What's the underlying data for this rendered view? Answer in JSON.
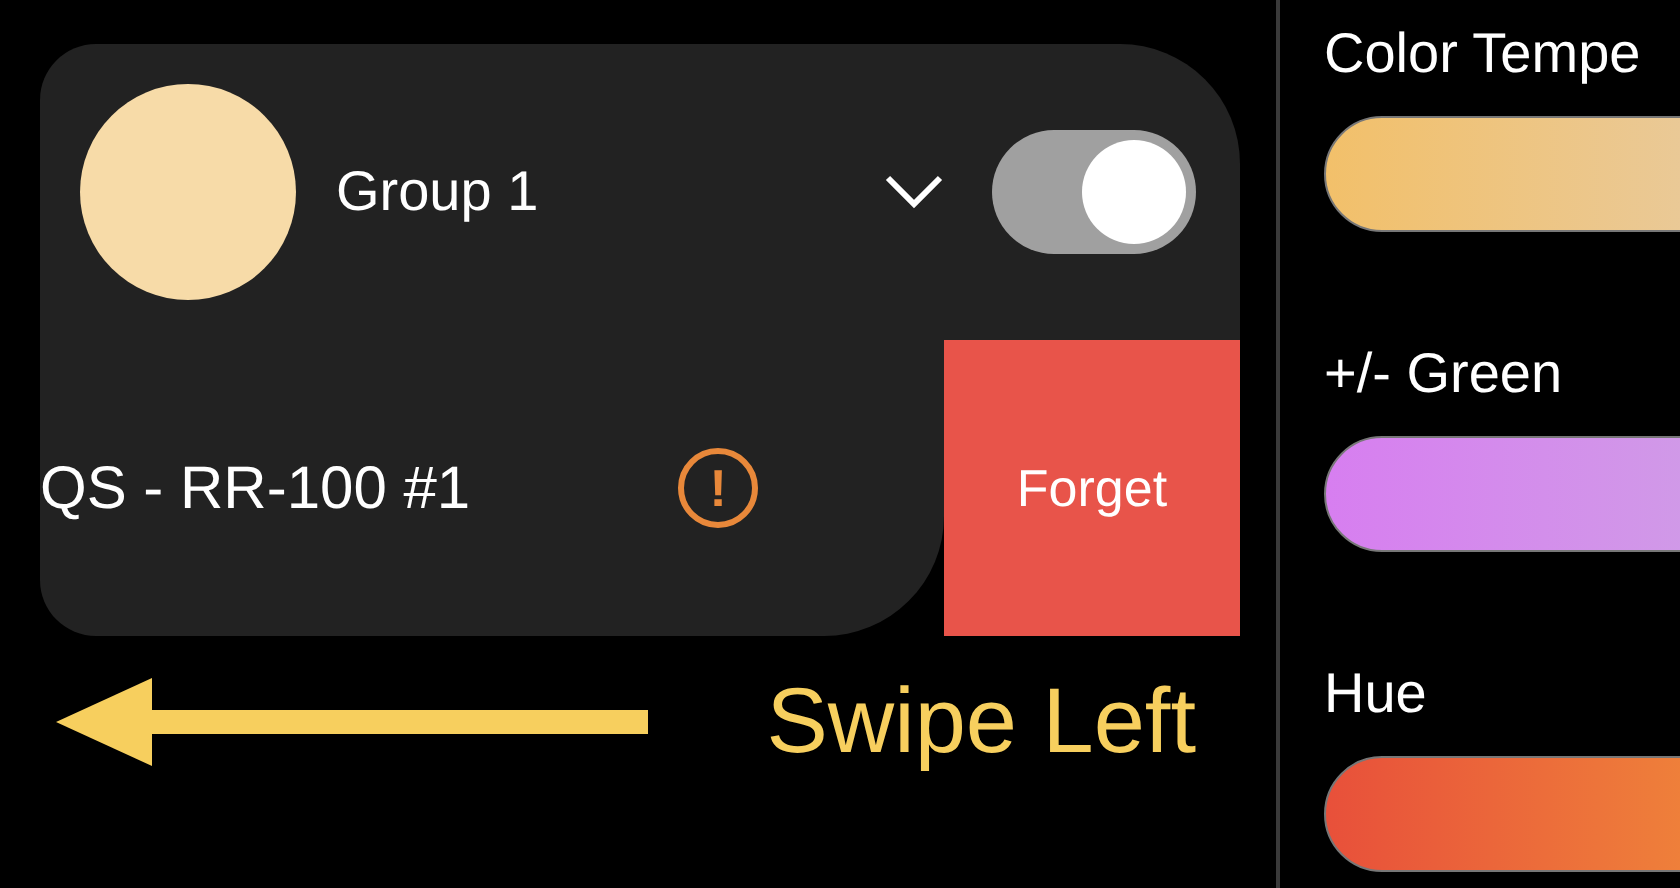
{
  "group": {
    "title": "Group 1",
    "color": "#f7dba8",
    "on": true
  },
  "device": {
    "name": "QS - RR-100 #1",
    "warning": "!",
    "action": "Forget"
  },
  "hint": {
    "text": "Swipe Left"
  },
  "sliders": [
    {
      "label": "Color Tempe",
      "kind": "temperature"
    },
    {
      "label": "+/- Green",
      "kind": "green"
    },
    {
      "label": "Hue",
      "kind": "hue"
    }
  ]
}
